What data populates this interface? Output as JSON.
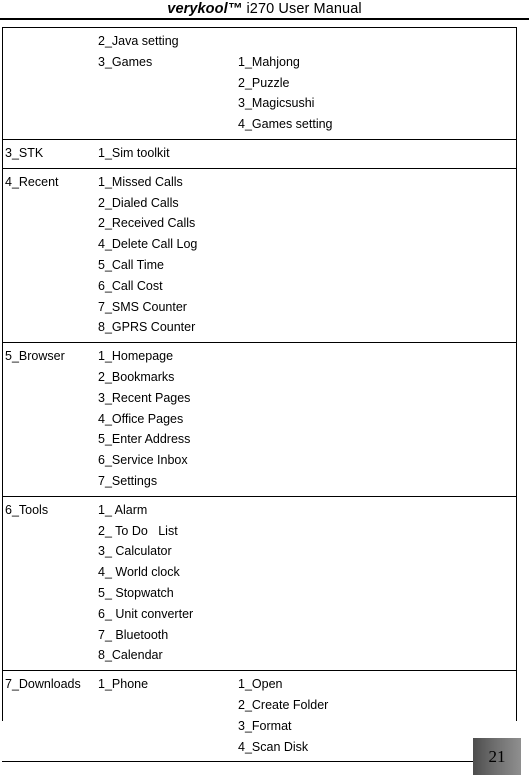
{
  "header": {
    "brand": "verykool™",
    "rest": " i270 User Manual"
  },
  "footer": {
    "page_number": "21"
  },
  "table": {
    "rows": [
      {
        "name": "row-games",
        "col1": [],
        "col2": [
          "2_Java setting",
          "3_Games"
        ],
        "col3": [
          "1_Mahjong",
          "2_Puzzle",
          "3_Magicsushi",
          "4_Games setting"
        ],
        "col3_offset_lines": 1
      },
      {
        "name": "row-stk",
        "col1": [
          "3_STK"
        ],
        "col2": [
          "1_Sim toolkit"
        ],
        "col3": [],
        "col3_offset_lines": 0
      },
      {
        "name": "row-recent",
        "col1": [
          "4_Recent"
        ],
        "col2": [
          "1_Missed Calls",
          "2_Dialed Calls",
          "2_Received Calls",
          "4_Delete Call Log",
          "5_Call Time",
          "6_Call Cost",
          "7_SMS Counter",
          "8_GPRS Counter"
        ],
        "col3": [],
        "col3_offset_lines": 0
      },
      {
        "name": "row-browser",
        "col1": [
          "5_Browser"
        ],
        "col2": [
          "1_Homepage",
          "2_Bookmarks",
          "3_Recent Pages",
          "4_Office Pages",
          "5_Enter Address",
          "6_Service Inbox",
          "7_Settings"
        ],
        "col3": [],
        "col3_offset_lines": 0
      },
      {
        "name": "row-tools",
        "col1": [
          "6_Tools"
        ],
        "col2": [
          "1_ Alarm",
          "2_ To Do   List",
          "3_ Calculator",
          "4_ World clock",
          "5_ Stopwatch",
          "6_ Unit converter",
          "7_ Bluetooth",
          "8_Calendar"
        ],
        "col3": [],
        "col3_offset_lines": 0
      },
      {
        "name": "row-downloads",
        "col1": [
          "7_Downloads"
        ],
        "col2": [
          "1_Phone"
        ],
        "col3": [
          "1_Open",
          "2_Create Folder",
          "3_Format",
          "4_Scan Disk"
        ],
        "col3_offset_lines": 0
      }
    ]
  }
}
